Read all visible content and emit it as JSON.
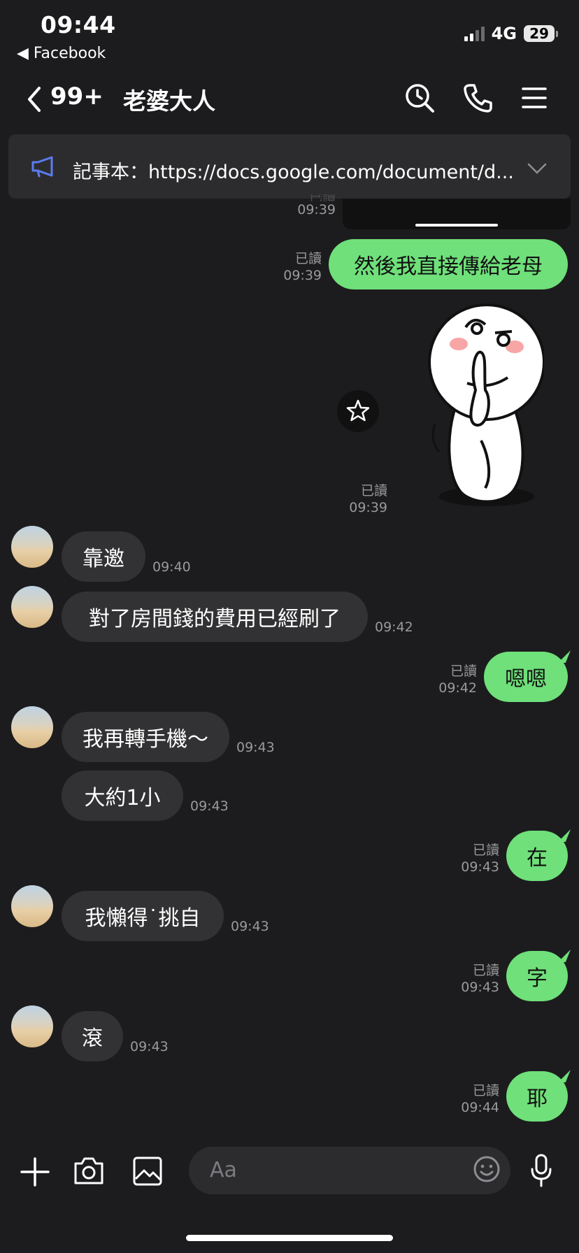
{
  "status_bar": {
    "time": "09:44",
    "back_app": "◀ Facebook",
    "network": "4G",
    "battery": "29"
  },
  "header": {
    "unread_count": "99+",
    "title": "老婆大人"
  },
  "notice": {
    "text": "記事本：https://docs.google.com/document/d..."
  },
  "messages": [
    {
      "side": "out-meta",
      "read": "已讀",
      "time": "09:39"
    },
    {
      "side": "out",
      "text": "然後我直接傳給老母",
      "read": "已讀",
      "time": "09:39"
    },
    {
      "side": "out-sticker",
      "read": "已讀",
      "time": "09:39"
    },
    {
      "side": "in",
      "text": "靠邀",
      "time": "09:40"
    },
    {
      "side": "in",
      "text": "對了房間錢的費用已經刷了",
      "time": "09:42"
    },
    {
      "side": "out",
      "text": "嗯嗯",
      "read": "已讀",
      "time": "09:42"
    },
    {
      "side": "in",
      "text": "我再轉手機～",
      "time": "09:43"
    },
    {
      "side": "in",
      "text": "大約1小",
      "time": "09:43"
    },
    {
      "side": "out",
      "text": "在",
      "read": "已讀",
      "time": "09:43"
    },
    {
      "side": "in",
      "text": "我懶得˙挑自",
      "time": "09:43"
    },
    {
      "side": "out",
      "text": "字",
      "read": "已讀",
      "time": "09:43"
    },
    {
      "side": "in",
      "text": "滾",
      "time": "09:43"
    },
    {
      "side": "out",
      "text": "耶",
      "read": "已讀",
      "time": "09:44"
    }
  ],
  "composer": {
    "placeholder": "Aa"
  },
  "icons": [
    "back-chevron-icon",
    "search-history-icon",
    "phone-icon",
    "menu-icon",
    "megaphone-icon",
    "chevron-down-icon",
    "star-icon",
    "plus-icon",
    "camera-icon",
    "image-icon",
    "emoji-icon",
    "microphone-icon"
  ],
  "colors": {
    "background": "#1c1c1e",
    "outgoing_bubble": "#6fe07a",
    "incoming_bubble": "#323234",
    "notice_icon": "#5b7cf0"
  }
}
